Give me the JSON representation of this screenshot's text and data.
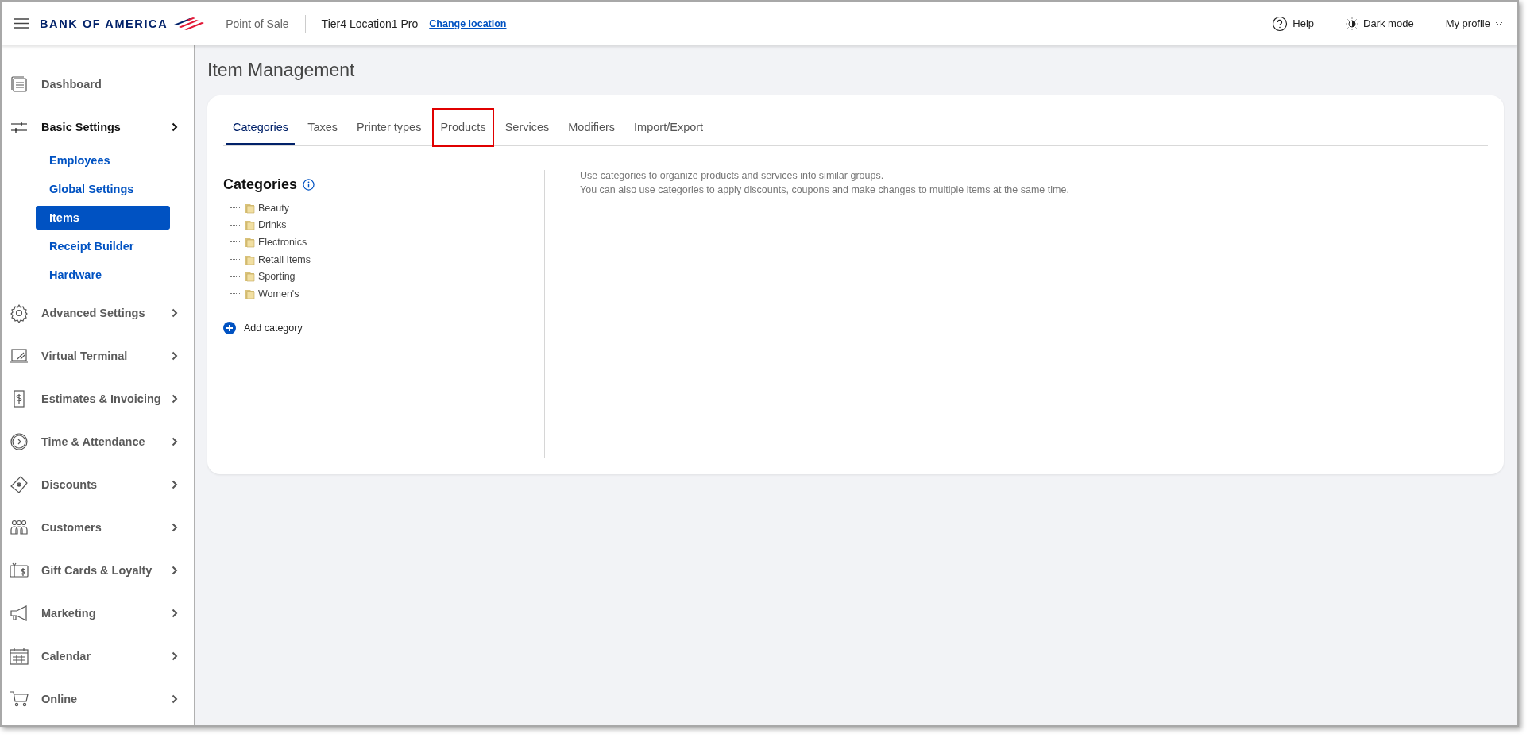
{
  "header": {
    "brand": "BANK OF AMERICA",
    "app": "Point of Sale",
    "location": "Tier4 Location1 Pro",
    "change_location": "Change location",
    "help": "Help",
    "dark_mode": "Dark mode",
    "profile": "My profile"
  },
  "sidebar": {
    "items": [
      {
        "label": "Dashboard",
        "expanded": false
      },
      {
        "label": "Basic Settings",
        "expanded": true,
        "children": [
          {
            "label": "Employees",
            "selected": false
          },
          {
            "label": "Global Settings",
            "selected": false
          },
          {
            "label": "Items",
            "selected": true
          },
          {
            "label": "Receipt Builder",
            "selected": false
          },
          {
            "label": "Hardware",
            "selected": false
          }
        ]
      },
      {
        "label": "Advanced Settings",
        "expanded": false
      },
      {
        "label": "Virtual Terminal",
        "expanded": false
      },
      {
        "label": "Estimates & Invoicing",
        "expanded": false
      },
      {
        "label": "Time & Attendance",
        "expanded": false
      },
      {
        "label": "Discounts",
        "expanded": false
      },
      {
        "label": "Customers",
        "expanded": false
      },
      {
        "label": "Gift Cards & Loyalty",
        "expanded": false
      },
      {
        "label": "Marketing",
        "expanded": false
      },
      {
        "label": "Calendar",
        "expanded": false
      },
      {
        "label": "Online",
        "expanded": false
      }
    ]
  },
  "page": {
    "title": "Item Management",
    "tabs": [
      {
        "label": "Categories",
        "selected": true,
        "highlighted": false
      },
      {
        "label": "Taxes",
        "selected": false,
        "highlighted": false
      },
      {
        "label": "Printer types",
        "selected": false,
        "highlighted": false
      },
      {
        "label": "Products",
        "selected": false,
        "highlighted": true
      },
      {
        "label": "Services",
        "selected": false,
        "highlighted": false
      },
      {
        "label": "Modifiers",
        "selected": false,
        "highlighted": false
      },
      {
        "label": "Import/Export",
        "selected": false,
        "highlighted": false
      }
    ],
    "categories": {
      "heading": "Categories",
      "items": [
        "Beauty",
        "Drinks",
        "Electronics",
        "Retail Items",
        "Sporting",
        "Women's"
      ],
      "add_label": "Add category"
    },
    "description": [
      "Use categories to organize products and services into similar groups.",
      "You can also use categories to apply discounts, coupons and make changes to multiple items at the same time."
    ]
  }
}
